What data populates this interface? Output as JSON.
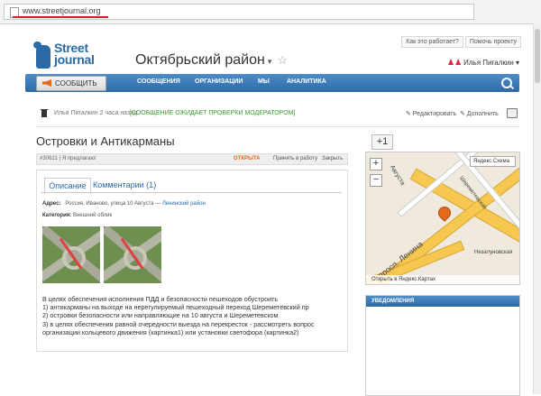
{
  "browser": {
    "url": "www.streetjournal.org"
  },
  "toplinks": [
    "Как это работает?",
    "Помочь проекту"
  ],
  "logo": {
    "line1": "Street",
    "line2": "journal"
  },
  "district": {
    "name": "Октябрьский район",
    "caret": "▾",
    "star": "☆"
  },
  "user": {
    "name": "Илья Пигалкин",
    "caret": "▾"
  },
  "nav": {
    "report": "СООБЩИТЬ",
    "items": [
      "СООБЩЕНИЯ",
      "ОРГАНИЗАЦИИ",
      "МЫ",
      "АНАЛИТИКА"
    ]
  },
  "author": {
    "name": "Илья Пигалкин 2 часа назад",
    "status": "[СООБЩЕНИЕ ОЖИДАЕТ ПРОВЕРКИ МОДЕРАТОРОМ]",
    "edit": "✎ Редактировать",
    "add": "✎ Дополнить"
  },
  "post": {
    "title": "Островки и Антикарманы",
    "number": "#30621",
    "proposed": "Я предлагаю!",
    "state": "ОТКРЫТА",
    "accept": "Принять в работу",
    "close": "Закрыть"
  },
  "plusone": "+1",
  "tabs": {
    "description": "Описание",
    "comments": "Комментарии (1)"
  },
  "fields": {
    "address_label": "Адрес:",
    "address_value": "Россия, Иваново, улица 10 Августа",
    "address_sep": "—",
    "district_link": "Ленинский район",
    "category_label": "Категория:",
    "category_value": "Внешний облик"
  },
  "description_lines": [
    "В целях обеспечения исполнения ПДД и безопасности пешеходов обустроить",
    "1) антикарманы на выходе на нерегулируемый пешеходный переход Шереметевский пр",
    "2) островки безопасности или направляющие на 10 августа и Шереметевском",
    "3) в целях обеспечения равной очередности выезда на перекресток - рассмотреть вопрос",
    "организации кольцевого движения (картинка1) или установки светофора (картинка2)"
  ],
  "map": {
    "scheme": "Яндекс.Схема",
    "zoom_in": "+",
    "zoom_out": "−",
    "labels": {
      "street1": "Августа",
      "street2": "просп. Ленина",
      "street3": "Шереметевский",
      "place": "Незалуновская"
    },
    "footer": "Открыть в Яндекс.Картах"
  },
  "notifications": {
    "title": "УВЕДОМЛЕНИЯ"
  }
}
